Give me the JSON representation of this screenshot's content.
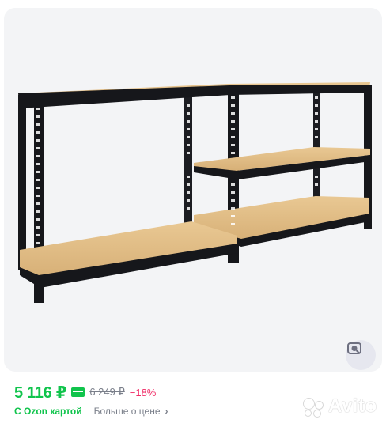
{
  "product": {
    "price": "5 116 ₽",
    "old_price": "6 249 ₽",
    "discount": "−18%",
    "ozon_card_text": "С Ozon картой",
    "more_about_price": "Больше о цене",
    "more_chevron": "›"
  },
  "watermark": {
    "text": "Avito"
  },
  "icons": {
    "payment": "ozon-card-icon",
    "search": "image-search-icon",
    "chevron": "chevron-right-icon"
  },
  "colors": {
    "price": "#10c44c",
    "discount": "#f02b66",
    "muted": "#7a7f8a",
    "card_background": "#f3f4f6",
    "shelf_wood": "#e2be86",
    "frame": "#15161a"
  }
}
